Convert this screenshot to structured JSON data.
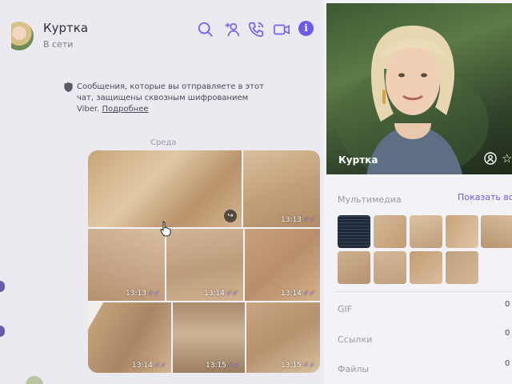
{
  "header": {
    "contact_name": "Куртка",
    "status": "В сети",
    "icons": [
      "search-icon",
      "add-participant-icon",
      "voice-call-icon",
      "video-call-icon",
      "info-icon"
    ],
    "accent_color": "#7360f2"
  },
  "encryption": {
    "text": "Сообщения, которые вы отправляете в этот чат, защищены сквозным шифрованием Viber.",
    "link": "Подробнее"
  },
  "day_label": "Среда",
  "photos": [
    {
      "time": "",
      "forward": true
    },
    {
      "time": "13:13"
    },
    {
      "time": "13:13"
    },
    {
      "time": "13:14"
    },
    {
      "time": "13:14"
    },
    {
      "time": "13:14"
    },
    {
      "time": "13:15"
    },
    {
      "time": "13:15"
    }
  ],
  "read_ticks": "✓✓",
  "info_panel": {
    "profile_name": "Куртка",
    "media_title": "Мультимедиа",
    "show_all": "Показать все",
    "rows": [
      {
        "label": "GIF",
        "count": "0"
      },
      {
        "label": "Ссылки",
        "count": "0"
      },
      {
        "label": "Файлы",
        "count": "0"
      }
    ]
  }
}
